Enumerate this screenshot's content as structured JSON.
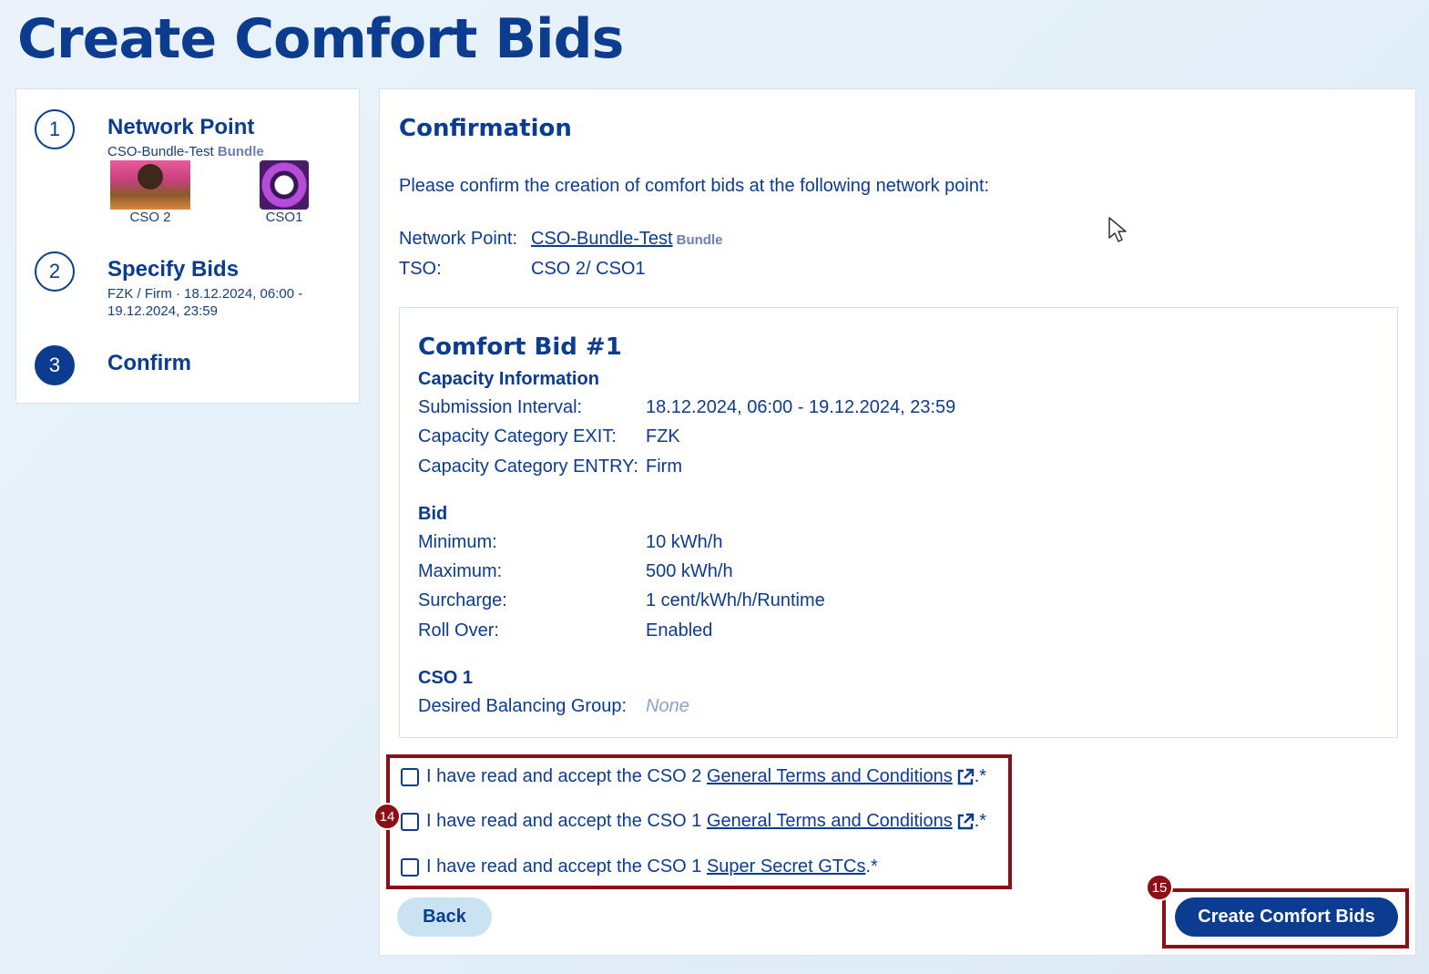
{
  "page": {
    "title": "Create Comfort Bids"
  },
  "stepper": {
    "steps": [
      {
        "number": "1",
        "title": "Network Point",
        "sub_name": "CSO-Bundle-Test",
        "sub_tag": "Bundle"
      },
      {
        "number": "2",
        "title": "Specify Bids",
        "sub_line1": "FZK / Firm · 18.12.2024, 06:00 -",
        "sub_line2": "19.12.2024, 23:59"
      },
      {
        "number": "3",
        "title": "Confirm",
        "state": "active"
      }
    ],
    "tso_logos": [
      {
        "label": "CSO 2"
      },
      {
        "label": "CSO1"
      }
    ]
  },
  "confirmation": {
    "title": "Confirmation",
    "intro": "Please confirm the creation of comfort bids at the following network point:",
    "network_point_label": "Network Point:",
    "network_point_value": "CSO-Bundle-Test",
    "network_point_tag": "Bundle",
    "tso_label": "TSO:",
    "tso_value": "CSO 2/ CSO1"
  },
  "bid": {
    "title": "Comfort Bid #1",
    "capacity_heading": "Capacity Information",
    "capacity_rows": [
      {
        "label": "Submission Interval:",
        "value": "18.12.2024, 06:00 - 19.12.2024, 23:59"
      },
      {
        "label": "Capacity Category EXIT:",
        "value": "FZK"
      },
      {
        "label": "Capacity Category ENTRY:",
        "value": "Firm"
      }
    ],
    "bid_heading": "Bid",
    "bid_rows": [
      {
        "label": "Minimum:",
        "value": "10 kWh/h"
      },
      {
        "label": "Maximum:",
        "value": "500 kWh/h"
      },
      {
        "label": "Surcharge:",
        "value": "1 cent/kWh/h/Runtime"
      },
      {
        "label": "Roll Over:",
        "value": "Enabled"
      }
    ],
    "cso_heading": "CSO 1",
    "cso_rows": [
      {
        "label": "Desired Balancing Group:",
        "value": "None"
      }
    ]
  },
  "terms": [
    {
      "prefix": "I have read and accept the CSO 2 ",
      "link": "General Terms and Conditions",
      "external": true,
      "suffix": ".*"
    },
    {
      "prefix": "I have read and accept the CSO 1 ",
      "link": "General Terms and Conditions",
      "external": true,
      "suffix": ".*"
    },
    {
      "prefix": "I have read and accept the CSO 1 ",
      "link": "Super Secret GTCs",
      "external": false,
      "suffix": ".*"
    }
  ],
  "markers": {
    "terms": "14",
    "create": "15"
  },
  "actions": {
    "back_label": "Back",
    "create_label": "Create Comfort Bids"
  },
  "icons": {
    "external_link": "external-link-icon",
    "cursor": "mouse-pointer-icon"
  },
  "colors": {
    "brand": "#0b3c8f",
    "marker": "#8b0f14",
    "back_bg": "#c9e3f2"
  }
}
